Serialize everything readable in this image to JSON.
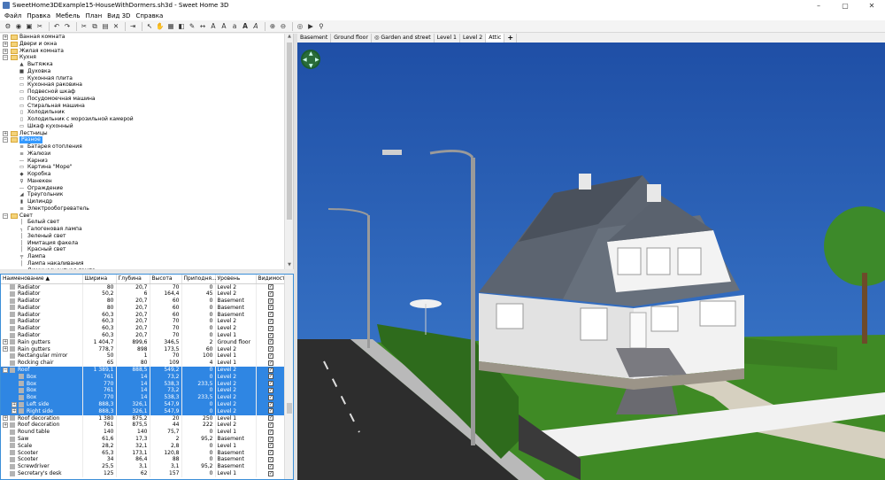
{
  "window": {
    "title": "SweetHome3DExample15-HouseWithDormers.sh3d - Sweet Home 3D",
    "controls": [
      "–",
      "▢",
      "✕"
    ]
  },
  "menu": [
    "Файл",
    "Правка",
    "Мебель",
    "План",
    "Вид 3D",
    "Справка"
  ],
  "toolbar_icons": [
    "new-icon",
    "open-icon",
    "save-icon",
    "cut-icon",
    "undo-icon",
    "redo-icon",
    "cut-icon",
    "copy-icon",
    "paste-icon",
    "delete-icon",
    "add-furniture-icon",
    "select-icon",
    "pan-icon",
    "create-walls-icon",
    "create-rooms-icon",
    "create-polylines-icon",
    "create-dimensions-icon",
    "create-labels-icon",
    "increase-text-icon",
    "decrease-text-icon",
    "bold-icon",
    "italic-icon",
    "zoom-in-icon",
    "zoom-out-icon",
    "create-photo-icon",
    "create-video-icon",
    "plugin-icon"
  ],
  "catalog": {
    "rows": [
      {
        "kind": "cat",
        "label": "Ванная комната",
        "exp": "+"
      },
      {
        "kind": "cat",
        "label": "Двери и окна",
        "exp": "+"
      },
      {
        "kind": "cat",
        "label": "Жилая комната",
        "exp": "+"
      },
      {
        "kind": "cat",
        "label": "Кухня",
        "exp": "−"
      },
      {
        "kind": "item",
        "label": "Вытяжка",
        "icon": "▲"
      },
      {
        "kind": "item",
        "label": "Духовка",
        "icon": "■"
      },
      {
        "kind": "item",
        "label": "Кухонная плита",
        "icon": "▭"
      },
      {
        "kind": "item",
        "label": "Кухонная раковина",
        "icon": "▭"
      },
      {
        "kind": "item",
        "label": "Подвесной шкаф",
        "icon": "▭"
      },
      {
        "kind": "item",
        "label": "Посудомоечная машина",
        "icon": "▭"
      },
      {
        "kind": "item",
        "label": "Стиральная машина",
        "icon": "▭"
      },
      {
        "kind": "item",
        "label": "Холодильник",
        "icon": "▯"
      },
      {
        "kind": "item",
        "label": "Холодильник с морозильной камерой",
        "icon": "▯"
      },
      {
        "kind": "item",
        "label": "Шкаф кухонный",
        "icon": "▭"
      },
      {
        "kind": "cat",
        "label": "Лестницы",
        "exp": "+"
      },
      {
        "kind": "cat",
        "label": "Разное",
        "exp": "−",
        "selected": true
      },
      {
        "kind": "item",
        "label": "Батарея отопления",
        "icon": "≡"
      },
      {
        "kind": "item",
        "label": "Жалюзи",
        "icon": "≡"
      },
      {
        "kind": "item",
        "label": "Карниз",
        "icon": "—"
      },
      {
        "kind": "item",
        "label": "Картина \"Море\"",
        "icon": "▭"
      },
      {
        "kind": "item",
        "label": "Коробка",
        "icon": "◆"
      },
      {
        "kind": "item",
        "label": "Манекен",
        "icon": "♀"
      },
      {
        "kind": "item",
        "label": "Ограждение",
        "icon": "—"
      },
      {
        "kind": "item",
        "label": "Треугольник",
        "icon": "◢"
      },
      {
        "kind": "item",
        "label": "Цилиндр",
        "icon": "▮"
      },
      {
        "kind": "item",
        "label": "Электрообогреватель",
        "icon": "≡"
      },
      {
        "kind": "cat",
        "label": "Свет",
        "exp": "−"
      },
      {
        "kind": "item",
        "label": "Белый свет",
        "icon": "│"
      },
      {
        "kind": "item",
        "label": "Галогеновая лампа",
        "icon": "╮"
      },
      {
        "kind": "item",
        "label": "Зеленый свет",
        "icon": "│"
      },
      {
        "kind": "item",
        "label": "Имитация факела",
        "icon": "│"
      },
      {
        "kind": "item",
        "label": "Красный свет",
        "icon": "│"
      },
      {
        "kind": "item",
        "label": "Лампа",
        "icon": "╤"
      },
      {
        "kind": "item",
        "label": "Лампа накаливания",
        "icon": "│"
      },
      {
        "kind": "item",
        "label": "Люминесцентная лампа",
        "icon": "─"
      }
    ]
  },
  "furniture": {
    "columns": [
      "Наименование ▲",
      "Ширина",
      "Глубина",
      "Высота",
      "Приподня...",
      "Уровень",
      "Видимость"
    ],
    "rows": [
      {
        "indent": 0,
        "exp": "",
        "name": "Radiator",
        "w": "80",
        "d": "20,7",
        "h": "70",
        "e": "0",
        "lvl": "Level 2",
        "vis": true
      },
      {
        "indent": 0,
        "exp": "",
        "name": "Radiator",
        "w": "50,2",
        "d": "6",
        "h": "164,4",
        "e": "45",
        "lvl": "Level 2",
        "vis": true
      },
      {
        "indent": 0,
        "exp": "",
        "name": "Radiator",
        "w": "80",
        "d": "20,7",
        "h": "60",
        "e": "0",
        "lvl": "Basement",
        "vis": true
      },
      {
        "indent": 0,
        "exp": "",
        "name": "Radiator",
        "w": "80",
        "d": "20,7",
        "h": "60",
        "e": "0",
        "lvl": "Basement",
        "vis": true
      },
      {
        "indent": 0,
        "exp": "",
        "name": "Radiator",
        "w": "60,3",
        "d": "20,7",
        "h": "60",
        "e": "0",
        "lvl": "Basement",
        "vis": true
      },
      {
        "indent": 0,
        "exp": "",
        "name": "Radiator",
        "w": "60,3",
        "d": "20,7",
        "h": "70",
        "e": "0",
        "lvl": "Level 2",
        "vis": true
      },
      {
        "indent": 0,
        "exp": "",
        "name": "Radiator",
        "w": "60,3",
        "d": "20,7",
        "h": "70",
        "e": "0",
        "lvl": "Level 2",
        "vis": true
      },
      {
        "indent": 0,
        "exp": "",
        "name": "Radiator",
        "w": "60,3",
        "d": "20,7",
        "h": "70",
        "e": "0",
        "lvl": "Level 1",
        "vis": true
      },
      {
        "indent": 0,
        "exp": "+",
        "name": "Rain gutters",
        "w": "1 404,7",
        "d": "899,6",
        "h": "346,5",
        "e": "2",
        "lvl": "Ground floor",
        "vis": true
      },
      {
        "indent": 0,
        "exp": "+",
        "name": "Rain gutters",
        "w": "778,7",
        "d": "898",
        "h": "173,5",
        "e": "60",
        "lvl": "Level 2",
        "vis": true
      },
      {
        "indent": 0,
        "exp": "",
        "name": "Rectangular mirror",
        "w": "50",
        "d": "1",
        "h": "70",
        "e": "100",
        "lvl": "Level 1",
        "vis": true
      },
      {
        "indent": 0,
        "exp": "",
        "name": "Rocking chair",
        "w": "65",
        "d": "80",
        "h": "109",
        "e": "4",
        "lvl": "Level 1",
        "vis": true
      },
      {
        "indent": 0,
        "exp": "−",
        "name": "Roof",
        "w": "1 389,1",
        "d": "888,5",
        "h": "549,2",
        "e": "0",
        "lvl": "Level 2",
        "vis": true,
        "sel": true
      },
      {
        "indent": 1,
        "exp": "",
        "name": "Box",
        "w": "761",
        "d": "14",
        "h": "73,2",
        "e": "0",
        "lvl": "Level 2",
        "vis": true,
        "sel": true
      },
      {
        "indent": 1,
        "exp": "",
        "name": "Box",
        "w": "770",
        "d": "14",
        "h": "538,3",
        "e": "233,5",
        "lvl": "Level 2",
        "vis": true,
        "sel": true
      },
      {
        "indent": 1,
        "exp": "",
        "name": "Box",
        "w": "761",
        "d": "14",
        "h": "73,2",
        "e": "0",
        "lvl": "Level 2",
        "vis": true,
        "sel": true
      },
      {
        "indent": 1,
        "exp": "",
        "name": "Box",
        "w": "770",
        "d": "14",
        "h": "538,3",
        "e": "233,5",
        "lvl": "Level 2",
        "vis": true,
        "sel": true
      },
      {
        "indent": 1,
        "exp": "+",
        "name": "Left side",
        "w": "888,3",
        "d": "326,1",
        "h": "547,9",
        "e": "0",
        "lvl": "Level 2",
        "vis": true,
        "sel": true
      },
      {
        "indent": 1,
        "exp": "+",
        "name": "Right side",
        "w": "888,3",
        "d": "326,1",
        "h": "547,9",
        "e": "0",
        "lvl": "Level 2",
        "vis": true,
        "sel": true
      },
      {
        "indent": 0,
        "exp": "+",
        "name": "Roof decoration",
        "w": "1 380",
        "d": "875,2",
        "h": "20",
        "e": "250",
        "lvl": "Level 1",
        "vis": true
      },
      {
        "indent": 0,
        "exp": "+",
        "name": "Roof decoration",
        "w": "761",
        "d": "875,5",
        "h": "44",
        "e": "222",
        "lvl": "Level 2",
        "vis": true
      },
      {
        "indent": 0,
        "exp": "",
        "name": "Round table",
        "w": "140",
        "d": "140",
        "h": "75,7",
        "e": "0",
        "lvl": "Level 1",
        "vis": true
      },
      {
        "indent": 0,
        "exp": "",
        "name": "Saw",
        "w": "61,6",
        "d": "17,3",
        "h": "2",
        "e": "95,2",
        "lvl": "Basement",
        "vis": true
      },
      {
        "indent": 0,
        "exp": "",
        "name": "Scale",
        "w": "28,2",
        "d": "32,1",
        "h": "2,8",
        "e": "0",
        "lvl": "Level 1",
        "vis": true
      },
      {
        "indent": 0,
        "exp": "",
        "name": "Scooter",
        "w": "65,3",
        "d": "173,1",
        "h": "120,8",
        "e": "0",
        "lvl": "Basement",
        "vis": true
      },
      {
        "indent": 0,
        "exp": "",
        "name": "Scooter",
        "w": "34",
        "d": "86,4",
        "h": "88",
        "e": "0",
        "lvl": "Basement",
        "vis": true
      },
      {
        "indent": 0,
        "exp": "",
        "name": "Screwdriver",
        "w": "25,5",
        "d": "3,1",
        "h": "3,1",
        "e": "95,2",
        "lvl": "Basement",
        "vis": true
      },
      {
        "indent": 0,
        "exp": "",
        "name": "Secretary's desk",
        "w": "125",
        "d": "62",
        "h": "157",
        "e": "0",
        "lvl": "Level 1",
        "vis": true
      }
    ]
  },
  "levels": {
    "tabs": [
      "Basement",
      "Ground floor",
      "Garden and street",
      "Level 1",
      "Level 2",
      "Attic"
    ],
    "active": "Attic",
    "add_label": "+"
  },
  "colors": {
    "sky": "#2a5fb6",
    "selection": "#2f86e3",
    "accent": "#3399ff"
  }
}
